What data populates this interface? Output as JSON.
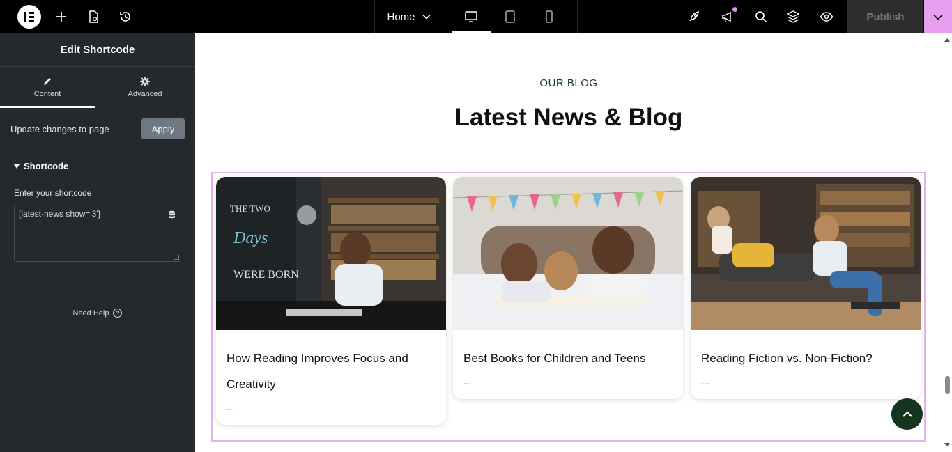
{
  "topbar": {
    "page_select": "Home",
    "publish_label": "Publish",
    "colors": {
      "background": "#000000",
      "accent": "#e6a0ef"
    },
    "icons": [
      "elementor-logo-icon",
      "plus-icon",
      "page-settings-icon",
      "history-icon",
      "chevron-down-icon",
      "desktop-icon",
      "tablet-icon",
      "mobile-icon",
      "rocket-icon",
      "megaphone-icon",
      "search-icon",
      "layers-icon",
      "eye-icon"
    ]
  },
  "panel": {
    "title": "Edit Shortcode",
    "tabs": [
      {
        "label": "Content",
        "icon": "pencil-icon",
        "active": true
      },
      {
        "label": "Advanced",
        "icon": "gear-icon",
        "active": false
      }
    ],
    "update_label": "Update changes to page",
    "apply_label": "Apply",
    "section_title": "Shortcode",
    "field_label": "Enter your shortcode",
    "shortcode_value": "[latest-news show='3']",
    "help_label": "Need Help",
    "colors": {
      "background": "#26292c",
      "apply_button": "#6d7882"
    }
  },
  "canvas": {
    "kicker": "OUR BLOG",
    "heading": "Latest News & Blog",
    "posts": [
      {
        "title": "How Reading Improves Focus and Creativity",
        "excerpt": "..."
      },
      {
        "title": "Best Books for Children and Teens",
        "excerpt": "..."
      },
      {
        "title": "Reading Fiction vs. Non-Fiction?",
        "excerpt": "..."
      }
    ],
    "colors": {
      "kicker": "#1c3a20",
      "scroll_top_button": "#16351f",
      "widget_outline": "#e3b2ef"
    }
  }
}
